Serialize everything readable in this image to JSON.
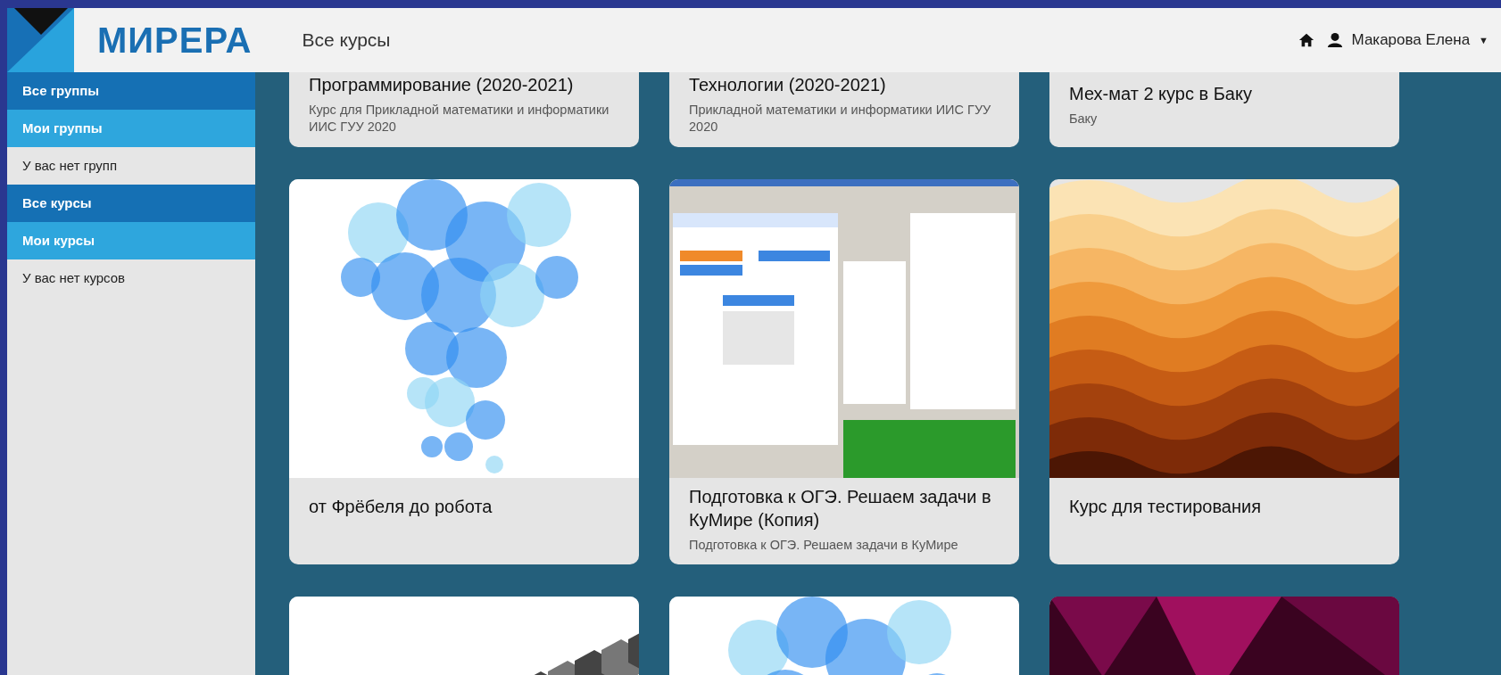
{
  "header": {
    "logo_text": "МИРЕРА",
    "page_title": "Все курсы",
    "user_name": "Макарова Елена",
    "menu_caret": "▼"
  },
  "sidebar": {
    "items": [
      {
        "label": "Все группы",
        "kind": "heading"
      },
      {
        "label": "Мои группы",
        "kind": "subheading"
      },
      {
        "label": "У вас нет групп",
        "kind": "note"
      },
      {
        "label": "Все курсы",
        "kind": "heading"
      },
      {
        "label": "Мои курсы",
        "kind": "subheading"
      },
      {
        "label": "У вас нет курсов",
        "kind": "note"
      }
    ]
  },
  "courses": [
    {
      "title": "Программирование (2020-2021)",
      "description": "Курс для Прикладной математики и информатики ИИС ГУУ 2020"
    },
    {
      "title": "Технологии (2020-2021)",
      "description": "Прикладной математики и информатики ИИС ГУУ 2020"
    },
    {
      "title": "Мех-мат 2 курс в Баку",
      "description": "Баку"
    },
    {
      "title": "от Фрёбеля до робота",
      "kind": "bubbles"
    },
    {
      "title": "Подготовка к ОГЭ. Решаем задачи в КуМире (Копия)",
      "description": "Подготовка к ОГЭ. Решаем задачи в КуМире",
      "kind": "screenshot"
    },
    {
      "title": "Курс для тестирования",
      "kind": "waves"
    },
    {
      "kind": "hexagons"
    },
    {
      "kind": "bubbles"
    },
    {
      "kind": "polygons"
    }
  ]
}
